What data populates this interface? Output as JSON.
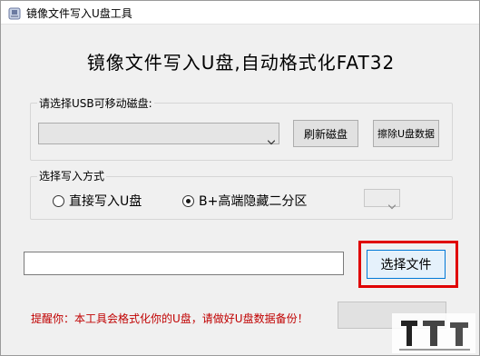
{
  "window": {
    "title": "镜像文件写入U盘工具"
  },
  "main": {
    "headline": "镜像文件写入U盘,自动格式化FAT32"
  },
  "usb_group": {
    "label": "请选择USB可移动磁盘:",
    "selected_disk": "",
    "refresh_button": "刷新磁盘",
    "erase_button": "擦除U盘数据"
  },
  "mode_group": {
    "label": "选择写入方式",
    "option_direct": "直接写入U盘",
    "option_hidden": "B+高端隐藏二分区",
    "selected": "option_hidden",
    "partition_value": ""
  },
  "file": {
    "path": "",
    "choose_button": "选择文件"
  },
  "warning_text": "提醒你：本工具会格式化你的U盘，请做好U盘数据备份！",
  "start_button": "",
  "colors": {
    "highlight": "#e00000",
    "warning": "#c00000"
  },
  "icons": {
    "app": "app-icon",
    "combo_arrow": "chevron-down-icon",
    "watermark": "logo"
  }
}
